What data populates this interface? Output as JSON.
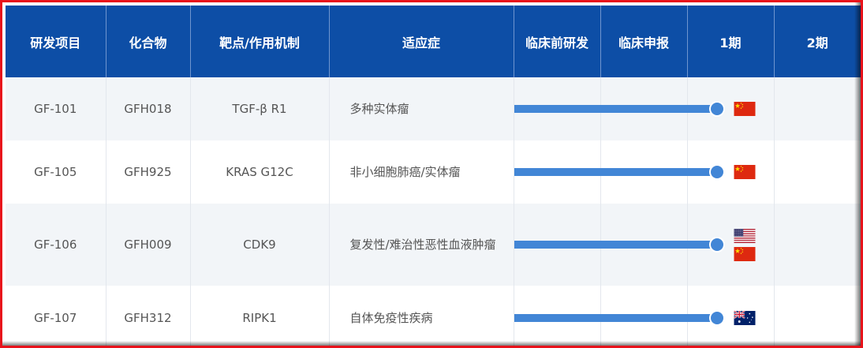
{
  "headers": [
    "研发项目",
    "化合物",
    "靶点/作用机制",
    "适应症",
    "临床前研发",
    "临床申报",
    "1期",
    "2期"
  ],
  "rows": [
    {
      "project": "GF-101",
      "compound": "GFH018",
      "target": "TGF-β R1",
      "indication": "多种实体瘤",
      "progress_pct": 78,
      "flags": [
        "china-flag-icon"
      ]
    },
    {
      "project": "GF-105",
      "compound": "GFH925",
      "target": "KRAS G12C",
      "indication": "非小细胞肺癌/实体瘤",
      "progress_pct": 78,
      "flags": [
        "china-flag-icon"
      ]
    },
    {
      "project": "GF-106",
      "compound": "GFH009",
      "target": "CDK9",
      "indication": "复发性/难治性恶性血液肿瘤",
      "progress_pct": 78,
      "flags": [
        "usa-flag-icon",
        "china-flag-icon"
      ]
    },
    {
      "project": "GF-107",
      "compound": "GFH312",
      "target": "RIPK1",
      "indication": "自体免疫性疾病",
      "progress_pct": 78,
      "flags": [
        "australia-flag-icon"
      ]
    }
  ],
  "colors": {
    "header_bg": "#0d4ea6",
    "progress_bar": "#4286d6",
    "frame_border": "#e8131b",
    "row_alt": "#f2f5f8"
  }
}
